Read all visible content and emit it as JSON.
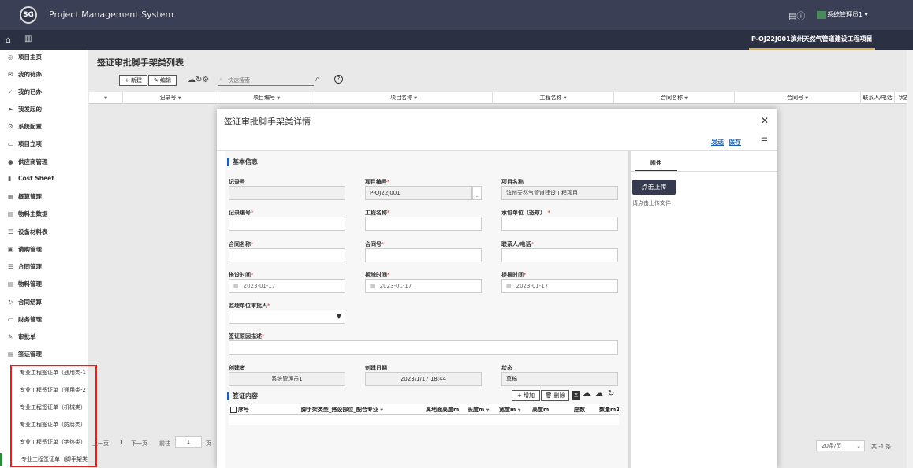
{
  "app": {
    "logo_text": "SG",
    "title": "Project Management System",
    "user": "系统管理员1"
  },
  "project_tab": "P-OJ22J001滨州天然气管道建设工程项目",
  "sidebar": {
    "items": [
      "项目主页",
      "我的待办",
      "我的已办",
      "我发起的",
      "系统配置",
      "项目立项",
      "供应商管理",
      "Cost Sheet",
      "概算管理",
      "物料主数据",
      "设备材料表",
      "请购管理",
      "合同管理",
      "物料管理",
      "合同结算",
      "财务管理",
      "审批单",
      "签证管理"
    ],
    "sub_items": [
      "专业工程签证单（通用类-1",
      "专业工程签证单（通用类-2",
      "专业工程签证单（机械类）",
      "专业工程签证单（防腐类）",
      "专业工程签证单（绝热类）",
      "专业工程签证单（脚手架类"
    ]
  },
  "list": {
    "title": "签证审批脚手架类列表",
    "new_btn": "+ 新建",
    "edit_btn": "✎ 编辑",
    "search_placeholder": "快速搜索",
    "columns": [
      "记录号",
      "项目编号",
      "项目名称",
      "工程名称",
      "合同名称",
      "合同号",
      "联系人/电话",
      "状态"
    ]
  },
  "pager": {
    "prev": "上一页",
    "page": "1",
    "next": "下一页",
    "goto": "前往",
    "goto_value": "1",
    "page_unit": "页",
    "size": "20条/页",
    "total": "共 -1 条"
  },
  "modal": {
    "title": "签证审批脚手架类详情",
    "send": "发送",
    "save": "保存",
    "basic_info": "基本信息",
    "fields": {
      "record_no": {
        "label": "记录号",
        "value": ""
      },
      "project_no": {
        "label": "项目编号",
        "value": "P-OJ22J001"
      },
      "project_name": {
        "label": "项目名称",
        "value": "滨州天然气管道建设工程项目"
      },
      "record_code": {
        "label": "记录编号",
        "value": ""
      },
      "work_name": {
        "label": "工程名称",
        "value": ""
      },
      "contractor": {
        "label": "承包单位（签章）",
        "value": ""
      },
      "contract_name": {
        "label": "合同名称",
        "value": ""
      },
      "contract_no": {
        "label": "合同号",
        "value": ""
      },
      "contact": {
        "label": "联系人/电话",
        "value": ""
      },
      "setup_time": {
        "label": "搭设时间",
        "value": "2023-01-17"
      },
      "remove_time": {
        "label": "拆除时间",
        "value": "2023-01-17"
      },
      "submit_time": {
        "label": "提报时间",
        "value": "2023-01-17"
      },
      "supervisor": {
        "label": "监理单位审批人",
        "value": ""
      },
      "reason": {
        "label": "签证原因描述",
        "value": ""
      },
      "creator": {
        "label": "创建者",
        "value": "系统管理员1"
      },
      "created_date": {
        "label": "创建日期",
        "value": "2023/1/17 18:44"
      },
      "status": {
        "label": "状态",
        "value": "草稿"
      }
    },
    "content_title": "签证内容",
    "add_btn": "+ 增加",
    "delete_btn": "🗑 删除",
    "sub_columns": [
      "序号",
      "脚手架类型_搭设部位_配合专业",
      "离地面高度m",
      "长度m",
      "宽度m",
      "高度m",
      "座数",
      "数量m2"
    ],
    "attachment": {
      "tab": "附件",
      "upload_btn": "点击上传",
      "hint": "请点击上传文件"
    }
  }
}
